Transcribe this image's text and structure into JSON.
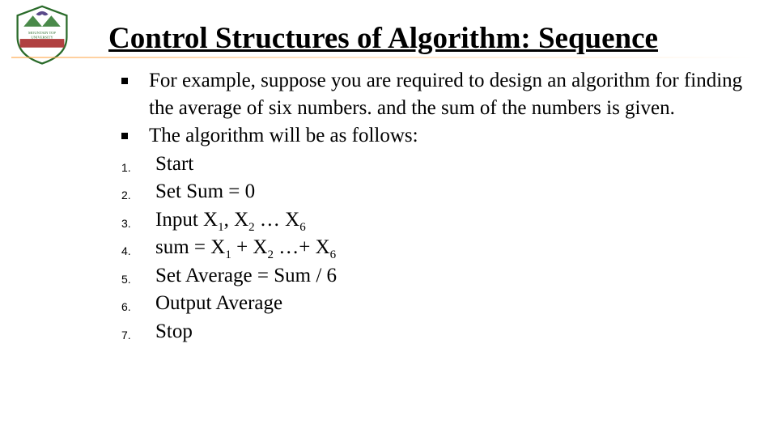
{
  "title_plain": "Control Structures of Algorithm: ",
  "title_bold": "Sequence",
  "bullets": {
    "b1": "For example, suppose you are required to design an algorithm for finding the average of six numbers. and the sum of the numbers is given.",
    "b2": "The algorithm will be as follows:"
  },
  "steps": {
    "n1": "1.",
    "s1": "Start",
    "n2": "2.",
    "s2": "Set Sum = 0",
    "n3": "3.",
    "s3_html": "Input X<sub>1</sub>, X<sub>2</sub> …    X<sub>6</sub>",
    "n4": "4.",
    "s4_html": " sum =  X<sub>1</sub> + X<sub>2</sub> …+ X<sub>6</sub>",
    "n5": "5.",
    "s5": "Set Average = Sum / 6",
    "n6": "6.",
    "s6": "Output  Average",
    "n7": "7.",
    "s7": "Stop"
  }
}
